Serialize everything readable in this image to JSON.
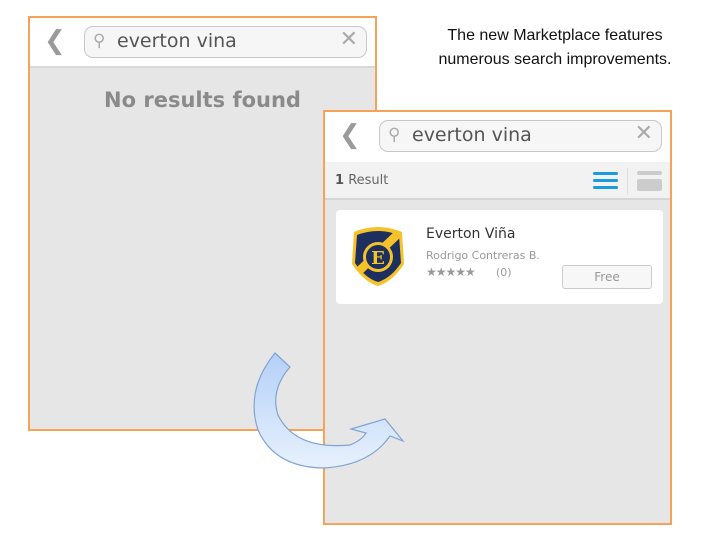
{
  "caption": {
    "line1": "The new Marketplace features",
    "line2": "numerous search improvements."
  },
  "before": {
    "search_query": "everton vina",
    "empty_message": "No results found"
  },
  "after": {
    "search_query": "everton vina",
    "result_count": "1",
    "result_label": "Result",
    "app": {
      "name": "Everton Viña",
      "developer": "Rodrigo Contreras B.",
      "rating": 0,
      "rating_count": "(0)",
      "price_label": "Free"
    }
  },
  "colors": {
    "panel_border": "#f6a35a",
    "accent": "#1a9ae0"
  }
}
